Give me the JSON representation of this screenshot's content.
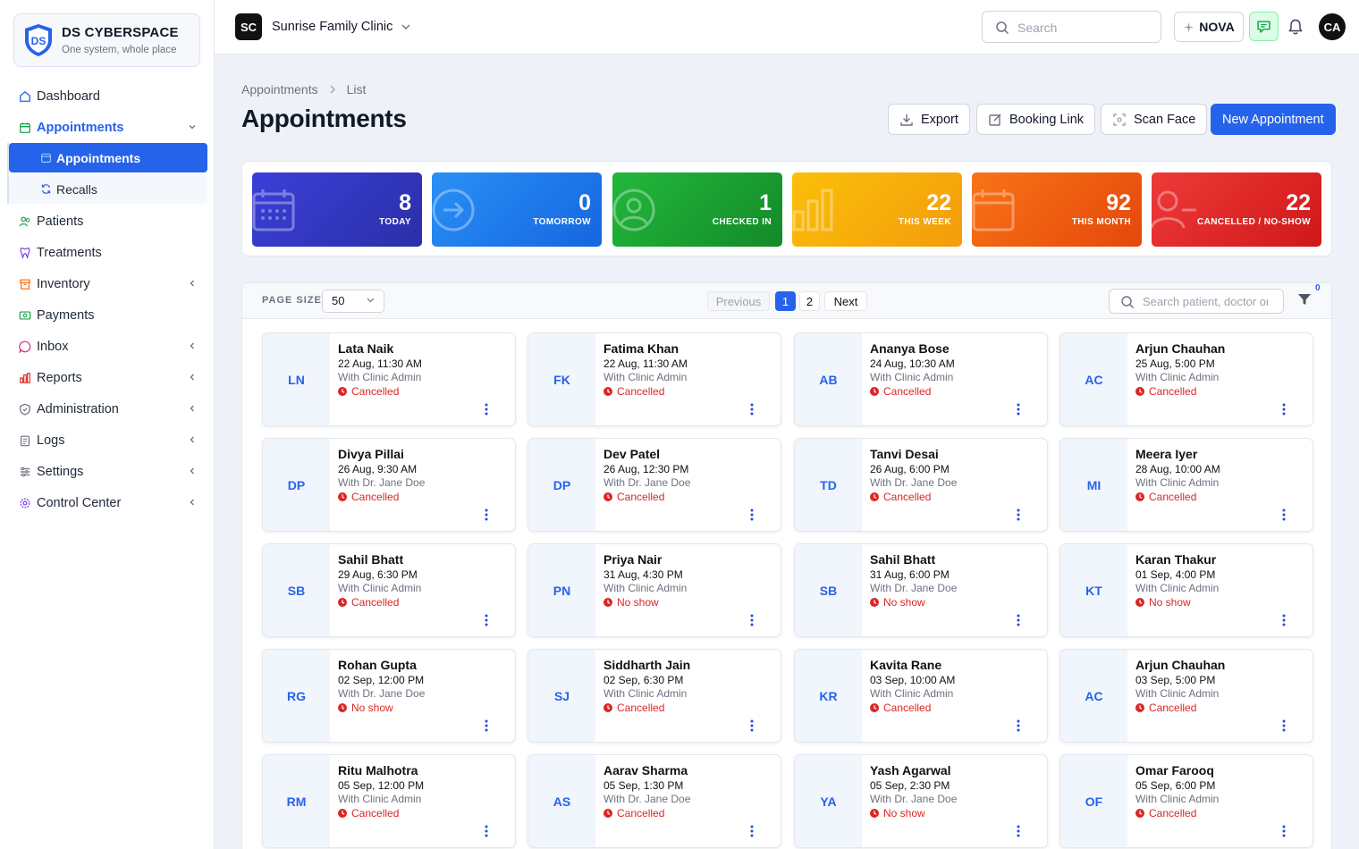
{
  "brand": {
    "name": "DS CYBERSPACE",
    "tagline": "One system, whole place",
    "logo_letters": "DS"
  },
  "sidebar": {
    "items": [
      {
        "label": "Dashboard",
        "icon": "home-icon"
      },
      {
        "label": "Appointments",
        "icon": "calendar-icon",
        "expanded": true
      },
      {
        "label": "Patients",
        "icon": "users-icon"
      },
      {
        "label": "Treatments",
        "icon": "tooth-icon"
      },
      {
        "label": "Inventory",
        "icon": "box-icon"
      },
      {
        "label": "Payments",
        "icon": "money-icon"
      },
      {
        "label": "Inbox",
        "icon": "whatsapp-icon"
      },
      {
        "label": "Reports",
        "icon": "bar-chart-icon"
      },
      {
        "label": "Administration",
        "icon": "shield-icon"
      },
      {
        "label": "Logs",
        "icon": "clipboard-icon"
      },
      {
        "label": "Settings",
        "icon": "sliders-icon"
      },
      {
        "label": "Control Center",
        "icon": "gear-icon"
      }
    ],
    "sub_items": [
      {
        "label": "Appointments",
        "active": true
      },
      {
        "label": "Recalls",
        "active": false
      }
    ]
  },
  "topbar": {
    "clinic_initials": "SC",
    "clinic_name": "Sunrise Family Clinic",
    "search_placeholder": "Search",
    "nova_label": "NOVA",
    "user_initials": "CA"
  },
  "breadcrumb": {
    "parent": "Appointments",
    "current": "List"
  },
  "page": {
    "title": "Appointments"
  },
  "actions": {
    "export": "Export",
    "booking_link": "Booking Link",
    "scan_face": "Scan Face",
    "new_appointment": "New Appointment"
  },
  "stats": [
    {
      "value": "8",
      "label": "TODAY",
      "color_from": "#3b3fd8",
      "color_to": "#2b2fa8"
    },
    {
      "value": "0",
      "label": "TOMORROW",
      "color_from": "#2a90f5",
      "color_to": "#1566e0"
    },
    {
      "value": "1",
      "label": "CHECKED IN",
      "color_from": "#22b83c",
      "color_to": "#138a28"
    },
    {
      "value": "22",
      "label": "THIS WEEK",
      "color_from": "#fbbf0a",
      "color_to": "#f39c0b"
    },
    {
      "value": "92",
      "label": "THIS MONTH",
      "color_from": "#f97316",
      "color_to": "#e4480b"
    },
    {
      "value": "22",
      "label": "CANCELLED / NO-SHOW",
      "color_from": "#ef3a3a",
      "color_to": "#cf1818"
    }
  ],
  "toolbar": {
    "page_size_label": "PAGE SIZE",
    "page_size": "50",
    "previous": "Previous",
    "pages": [
      "1",
      "2"
    ],
    "current_page": "1",
    "next": "Next",
    "search_placeholder": "Search patient, doctor or",
    "filter_count": "0"
  },
  "appointments": [
    {
      "initials": "LN",
      "name": "Lata Naik",
      "datetime": "22 Aug, 11:30 AM",
      "with": "With Clinic Admin",
      "status": "Cancelled"
    },
    {
      "initials": "FK",
      "name": "Fatima Khan",
      "datetime": "22 Aug, 11:30 AM",
      "with": "With Clinic Admin",
      "status": "Cancelled"
    },
    {
      "initials": "AB",
      "name": "Ananya Bose",
      "datetime": "24 Aug, 10:30 AM",
      "with": "With Clinic Admin",
      "status": "Cancelled"
    },
    {
      "initials": "AC",
      "name": "Arjun Chauhan",
      "datetime": "25 Aug, 5:00 PM",
      "with": "With Clinic Admin",
      "status": "Cancelled"
    },
    {
      "initials": "DP",
      "name": "Divya Pillai",
      "datetime": "26 Aug, 9:30 AM",
      "with": "With Dr. Jane Doe",
      "status": "Cancelled"
    },
    {
      "initials": "DP",
      "name": "Dev Patel",
      "datetime": "26 Aug, 12:30 PM",
      "with": "With Dr. Jane Doe",
      "status": "Cancelled"
    },
    {
      "initials": "TD",
      "name": "Tanvi Desai",
      "datetime": "26 Aug, 6:00 PM",
      "with": "With Dr. Jane Doe",
      "status": "Cancelled"
    },
    {
      "initials": "MI",
      "name": "Meera Iyer",
      "datetime": "28 Aug, 10:00 AM",
      "with": "With Clinic Admin",
      "status": "Cancelled"
    },
    {
      "initials": "SB",
      "name": "Sahil Bhatt",
      "datetime": "29 Aug, 6:30 PM",
      "with": "With Clinic Admin",
      "status": "Cancelled"
    },
    {
      "initials": "PN",
      "name": "Priya Nair",
      "datetime": "31 Aug, 4:30 PM",
      "with": "With Clinic Admin",
      "status": "No show"
    },
    {
      "initials": "SB",
      "name": "Sahil Bhatt",
      "datetime": "31 Aug, 6:00 PM",
      "with": "With Dr. Jane Doe",
      "status": "No show"
    },
    {
      "initials": "KT",
      "name": "Karan Thakur",
      "datetime": "01 Sep, 4:00 PM",
      "with": "With Clinic Admin",
      "status": "No show"
    },
    {
      "initials": "RG",
      "name": "Rohan Gupta",
      "datetime": "02 Sep, 12:00 PM",
      "with": "With Dr. Jane Doe",
      "status": "No show"
    },
    {
      "initials": "SJ",
      "name": "Siddharth Jain",
      "datetime": "02 Sep, 6:30 PM",
      "with": "With Clinic Admin",
      "status": "Cancelled"
    },
    {
      "initials": "KR",
      "name": "Kavita Rane",
      "datetime": "03 Sep, 10:00 AM",
      "with": "With Clinic Admin",
      "status": "Cancelled"
    },
    {
      "initials": "AC",
      "name": "Arjun Chauhan",
      "datetime": "03 Sep, 5:00 PM",
      "with": "With Clinic Admin",
      "status": "Cancelled"
    },
    {
      "initials": "RM",
      "name": "Ritu Malhotra",
      "datetime": "05 Sep, 12:00 PM",
      "with": "With Clinic Admin",
      "status": "Cancelled"
    },
    {
      "initials": "AS",
      "name": "Aarav Sharma",
      "datetime": "05 Sep, 1:30 PM",
      "with": "With Dr. Jane Doe",
      "status": "Cancelled"
    },
    {
      "initials": "YA",
      "name": "Yash Agarwal",
      "datetime": "05 Sep, 2:30 PM",
      "with": "With Dr. Jane Doe",
      "status": "No show"
    },
    {
      "initials": "OF",
      "name": "Omar Farooq",
      "datetime": "05 Sep, 6:00 PM",
      "with": "With Clinic Admin",
      "status": "Cancelled"
    }
  ]
}
